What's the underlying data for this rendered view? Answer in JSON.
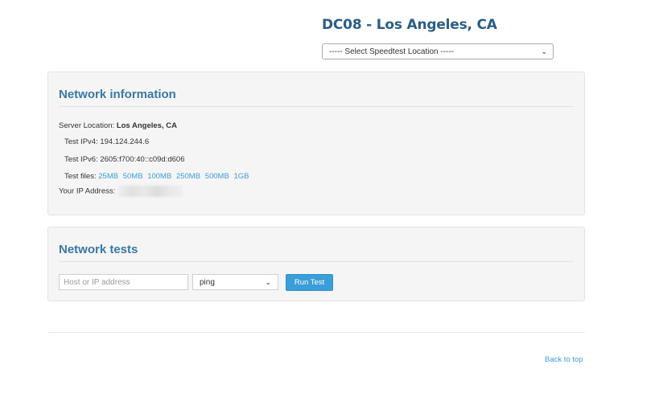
{
  "header": {
    "title": "DC08 - Los Angeles, CA",
    "location_select": "----- Select Speedtest Location -----"
  },
  "network_info": {
    "title": "Network information",
    "server_location_label": "Server Location:",
    "server_location_value": "Los Angeles, CA",
    "ipv4_label": "Test IPv4:",
    "ipv4_value": "194.124.244.6",
    "ipv6_label": "Test IPv6:",
    "ipv6_value": "2605:f700:40::c09d:d606",
    "test_files_label": "Test files:",
    "test_files": [
      "25MB",
      "50MB",
      "100MB",
      "250MB",
      "500MB",
      "1GB"
    ],
    "your_ip_label": "Your IP Address:"
  },
  "network_tests": {
    "title": "Network tests",
    "host_placeholder": "Host or IP address",
    "tool_selected": "ping",
    "run_label": "Run Test"
  },
  "footer": {
    "back_to_top": "Back to top"
  },
  "colors": {
    "title": "#2a5d86",
    "panel_title": "#3a78a6",
    "link": "#3b9ed8",
    "button": "#3b9ed8",
    "panel_bg": "#f5f5f5"
  }
}
